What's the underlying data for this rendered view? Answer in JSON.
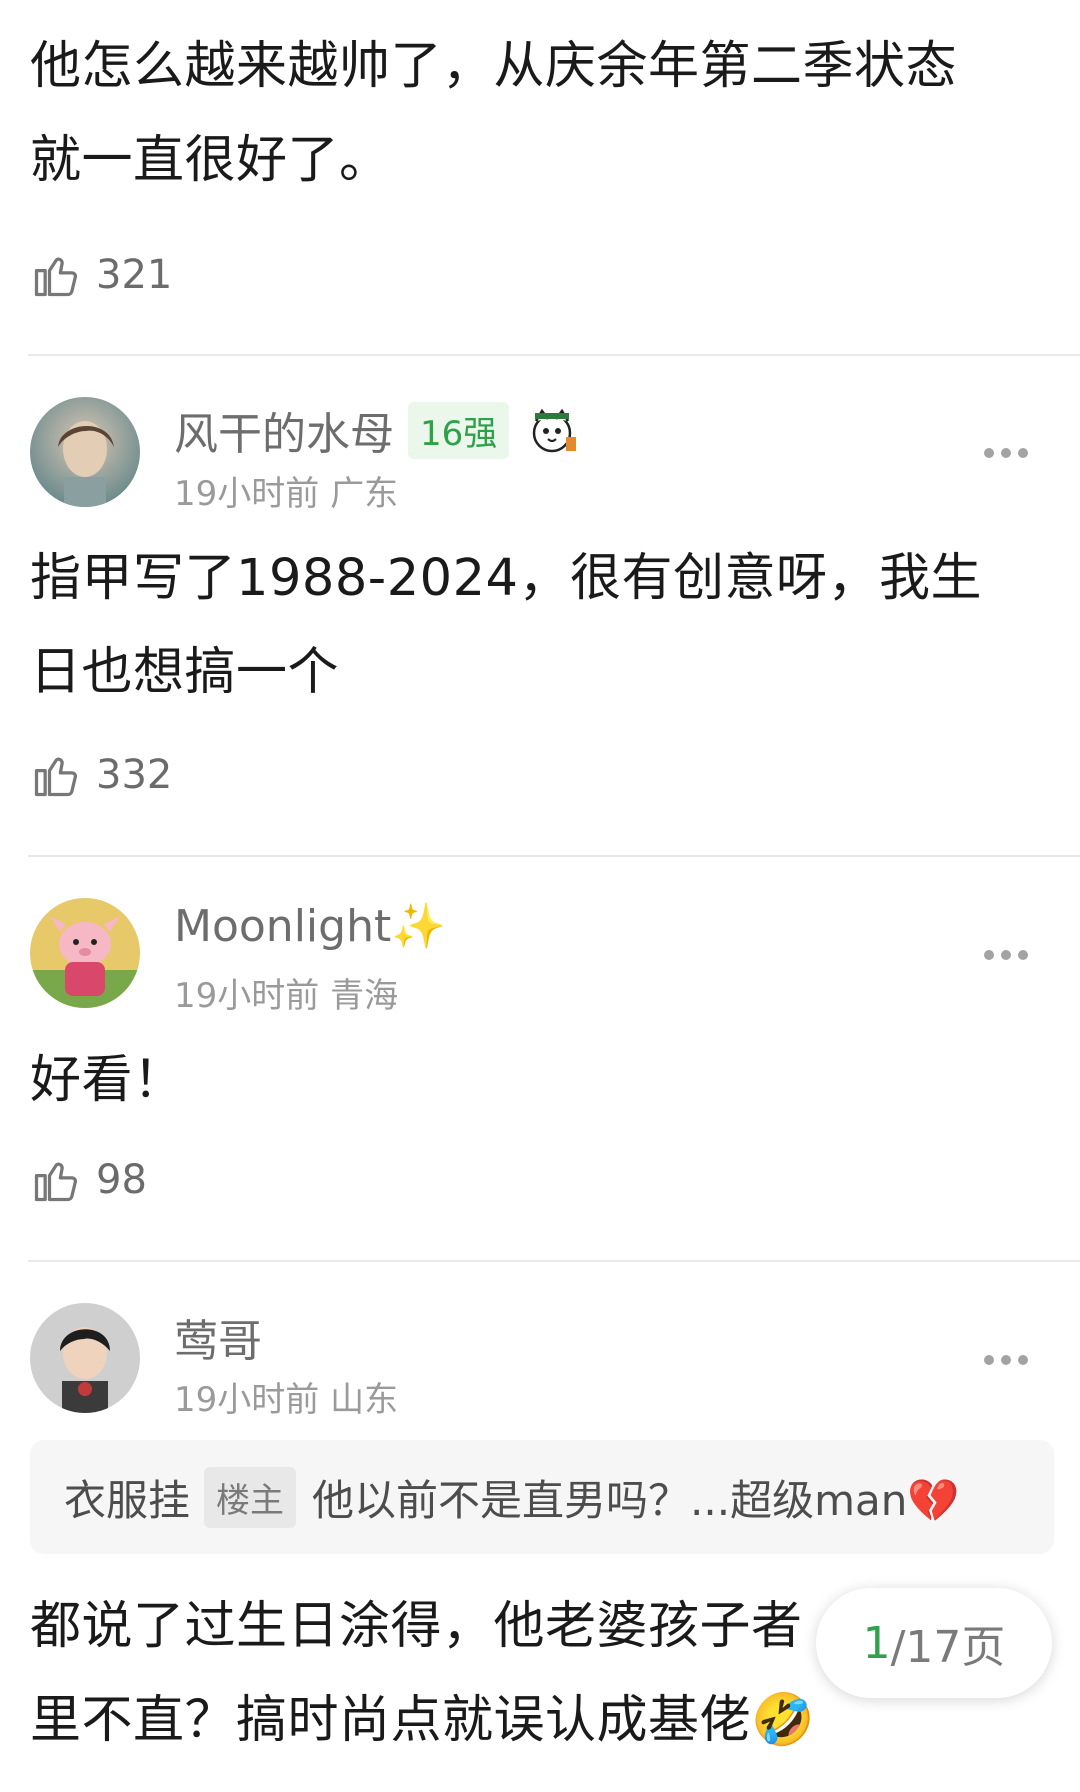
{
  "comments": [
    {
      "text_lines": [
        "他怎么越来越帅了，从庆余年第二季状态",
        "就一直很好了。"
      ],
      "likes": "321"
    },
    {
      "username": "风干的水母",
      "level": "16强",
      "badge_icon": "cartoon-cat-badge-icon",
      "meta": "19小时前 广东",
      "text_lines": [
        "指甲写了1988-2024，很有创意呀，我生",
        "日也想搞一个"
      ],
      "likes": "332"
    },
    {
      "username": "Moonlight✨",
      "meta": "19小时前 青海",
      "text_lines": [
        "好看！"
      ],
      "likes": "98"
    },
    {
      "username": "莺哥",
      "meta": "19小时前 山东",
      "quote": {
        "user": "衣服挂",
        "tag": "楼主",
        "text": "他以前不是直男吗？...超级man💔"
      },
      "text_lines": [
        "都说了过生日涂得，他老婆孩子者",
        "里不直？搞时尚点就误认成基佬🤣"
      ]
    }
  ],
  "pagination": {
    "current": "1",
    "rest": "/17页"
  },
  "colors": {
    "accent_green": "#2fa14a",
    "meta_gray": "#9a9a9a"
  },
  "icons": {
    "like": "thumbs-up-icon",
    "more": "more-dots-icon"
  }
}
